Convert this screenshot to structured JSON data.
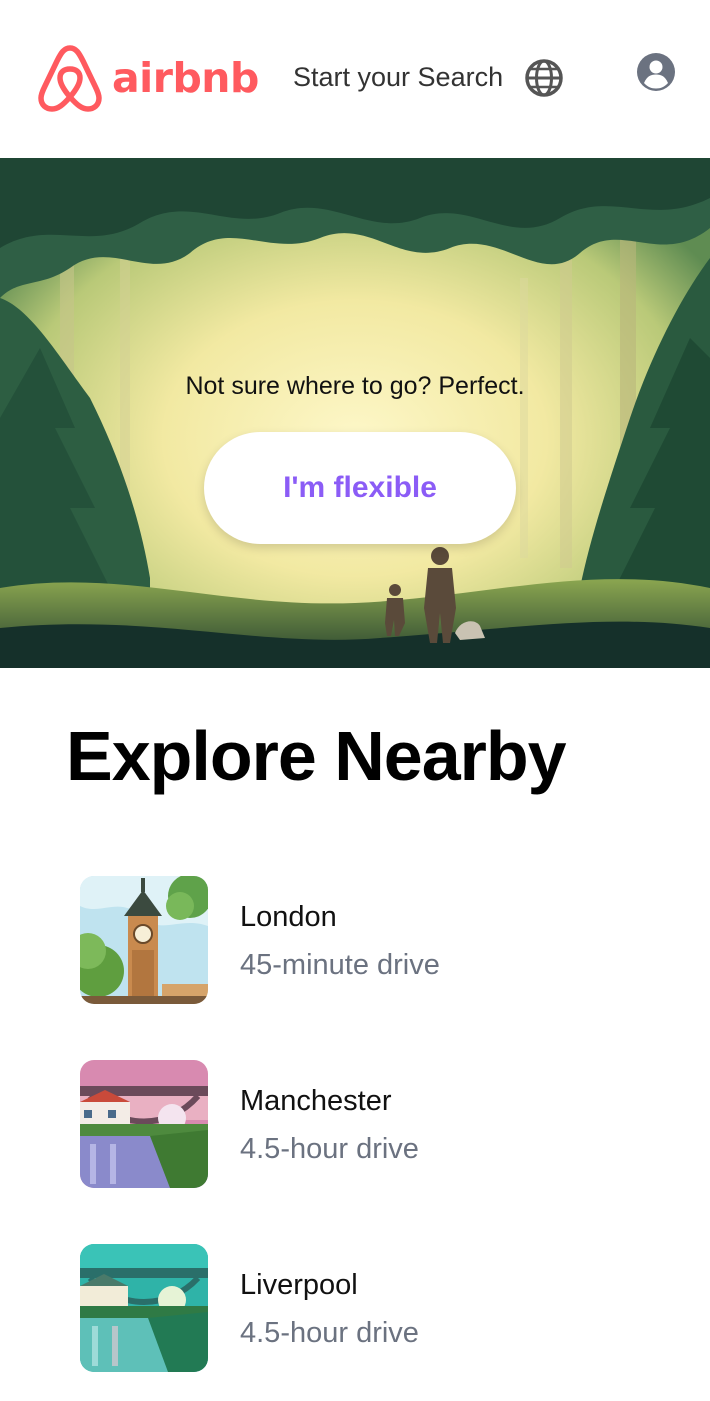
{
  "header": {
    "brand": "airbnb",
    "search_link": "Start your Search",
    "icons": {
      "logo": "airbnb-logo-icon",
      "globe": "globe-icon",
      "account": "user-circle-icon"
    },
    "brand_color": "#ff5a5f"
  },
  "hero": {
    "tagline": "Not sure where to go? Perfect.",
    "button_label": "I'm flexible",
    "button_color": "#8b5cf6"
  },
  "explore": {
    "title": "Explore Nearby",
    "places": [
      {
        "name": "London",
        "distance": "45-minute drive"
      },
      {
        "name": "Manchester",
        "distance": "4.5-hour drive"
      },
      {
        "name": "Liverpool",
        "distance": "4.5-hour drive"
      }
    ]
  }
}
